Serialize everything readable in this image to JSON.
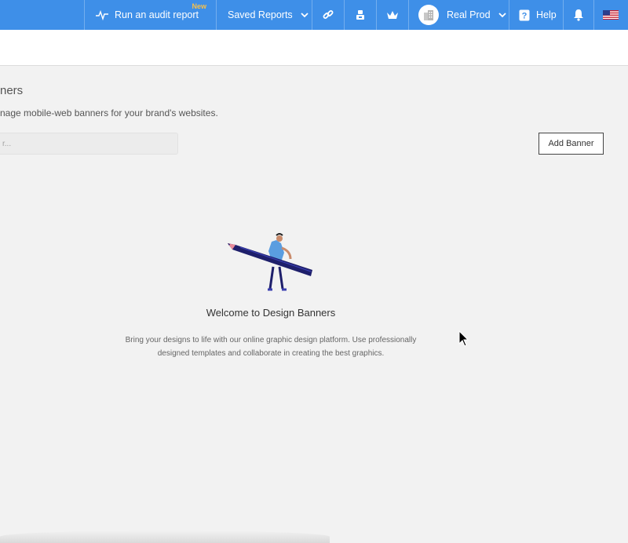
{
  "topbar": {
    "audit_label": "Run an audit report",
    "audit_badge": "New",
    "saved_reports_label": "Saved Reports",
    "account_label": "Real Prod",
    "help_label": "Help",
    "icons": [
      "activity-icon",
      "link-icon",
      "robot-icon",
      "crown-icon",
      "building-icon",
      "question-icon",
      "bell-icon",
      "us-flag-icon"
    ],
    "accent_color": "#3e8fe8",
    "badge_color": "#f7c04a"
  },
  "page": {
    "title": "ners",
    "description": "nage mobile-web banners for your brand's websites.",
    "search_placeholder": "r...",
    "add_button": "Add Banner"
  },
  "empty_state": {
    "title": "Welcome to Design Banners",
    "text": "Bring your designs to life with our online graphic design platform. Use professionally designed templates and collaborate in creating the best graphics."
  }
}
